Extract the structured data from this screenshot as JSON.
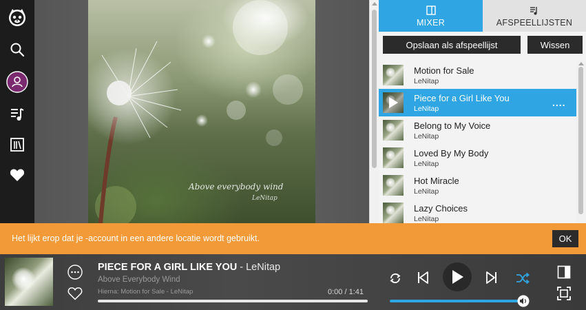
{
  "sidebar": {
    "items": [
      {
        "icon": "napster-logo"
      },
      {
        "icon": "search-icon"
      },
      {
        "icon": "user-icon",
        "active": true
      },
      {
        "icon": "playlist-icon"
      },
      {
        "icon": "library-icon"
      },
      {
        "icon": "heart-icon"
      }
    ]
  },
  "artwork": {
    "caption": "Above everybody wind",
    "signature": "LeNitap"
  },
  "panel": {
    "tabs": [
      {
        "label": "MIXER",
        "icon": "mixer-icon",
        "active": true
      },
      {
        "label": "AFSPEELLIJSTEN",
        "icon": "playlist-icon",
        "active": false
      }
    ],
    "save_label": "Opslaan als afspeellijst",
    "clear_label": "Wissen",
    "tracks": [
      {
        "title": "Motion for Sale",
        "artist": "LeNitap"
      },
      {
        "title": "Piece for a Girl Like You",
        "artist": "LeNitap",
        "playing": true,
        "more": "...."
      },
      {
        "title": "Belong to My Voice",
        "artist": "LeNitap"
      },
      {
        "title": "Loved By My Body",
        "artist": "LeNitap"
      },
      {
        "title": "Hot Miracle",
        "artist": "LeNitap"
      },
      {
        "title": "Lazy Choices",
        "artist": "LeNitap"
      }
    ]
  },
  "banner": {
    "text": "Het lijkt erop dat je -account in een andere locatie wordt gebruikt.",
    "ok_label": "OK",
    "color": "#f29a38"
  },
  "player": {
    "song": "PIECE FOR A GIRL LIKE YOU",
    "artist_sep": " - LeNitap",
    "album": "Above Everybody Wind",
    "next_up": "Hierna: Motion for Sale - LeNitap",
    "time": "0:00 / 1:41",
    "progress": 0,
    "volume": 1.0
  },
  "colors": {
    "accent": "#2fa5e3",
    "sidebar_bg": "#1c1c1c",
    "button_dark": "#2b2b2b"
  }
}
